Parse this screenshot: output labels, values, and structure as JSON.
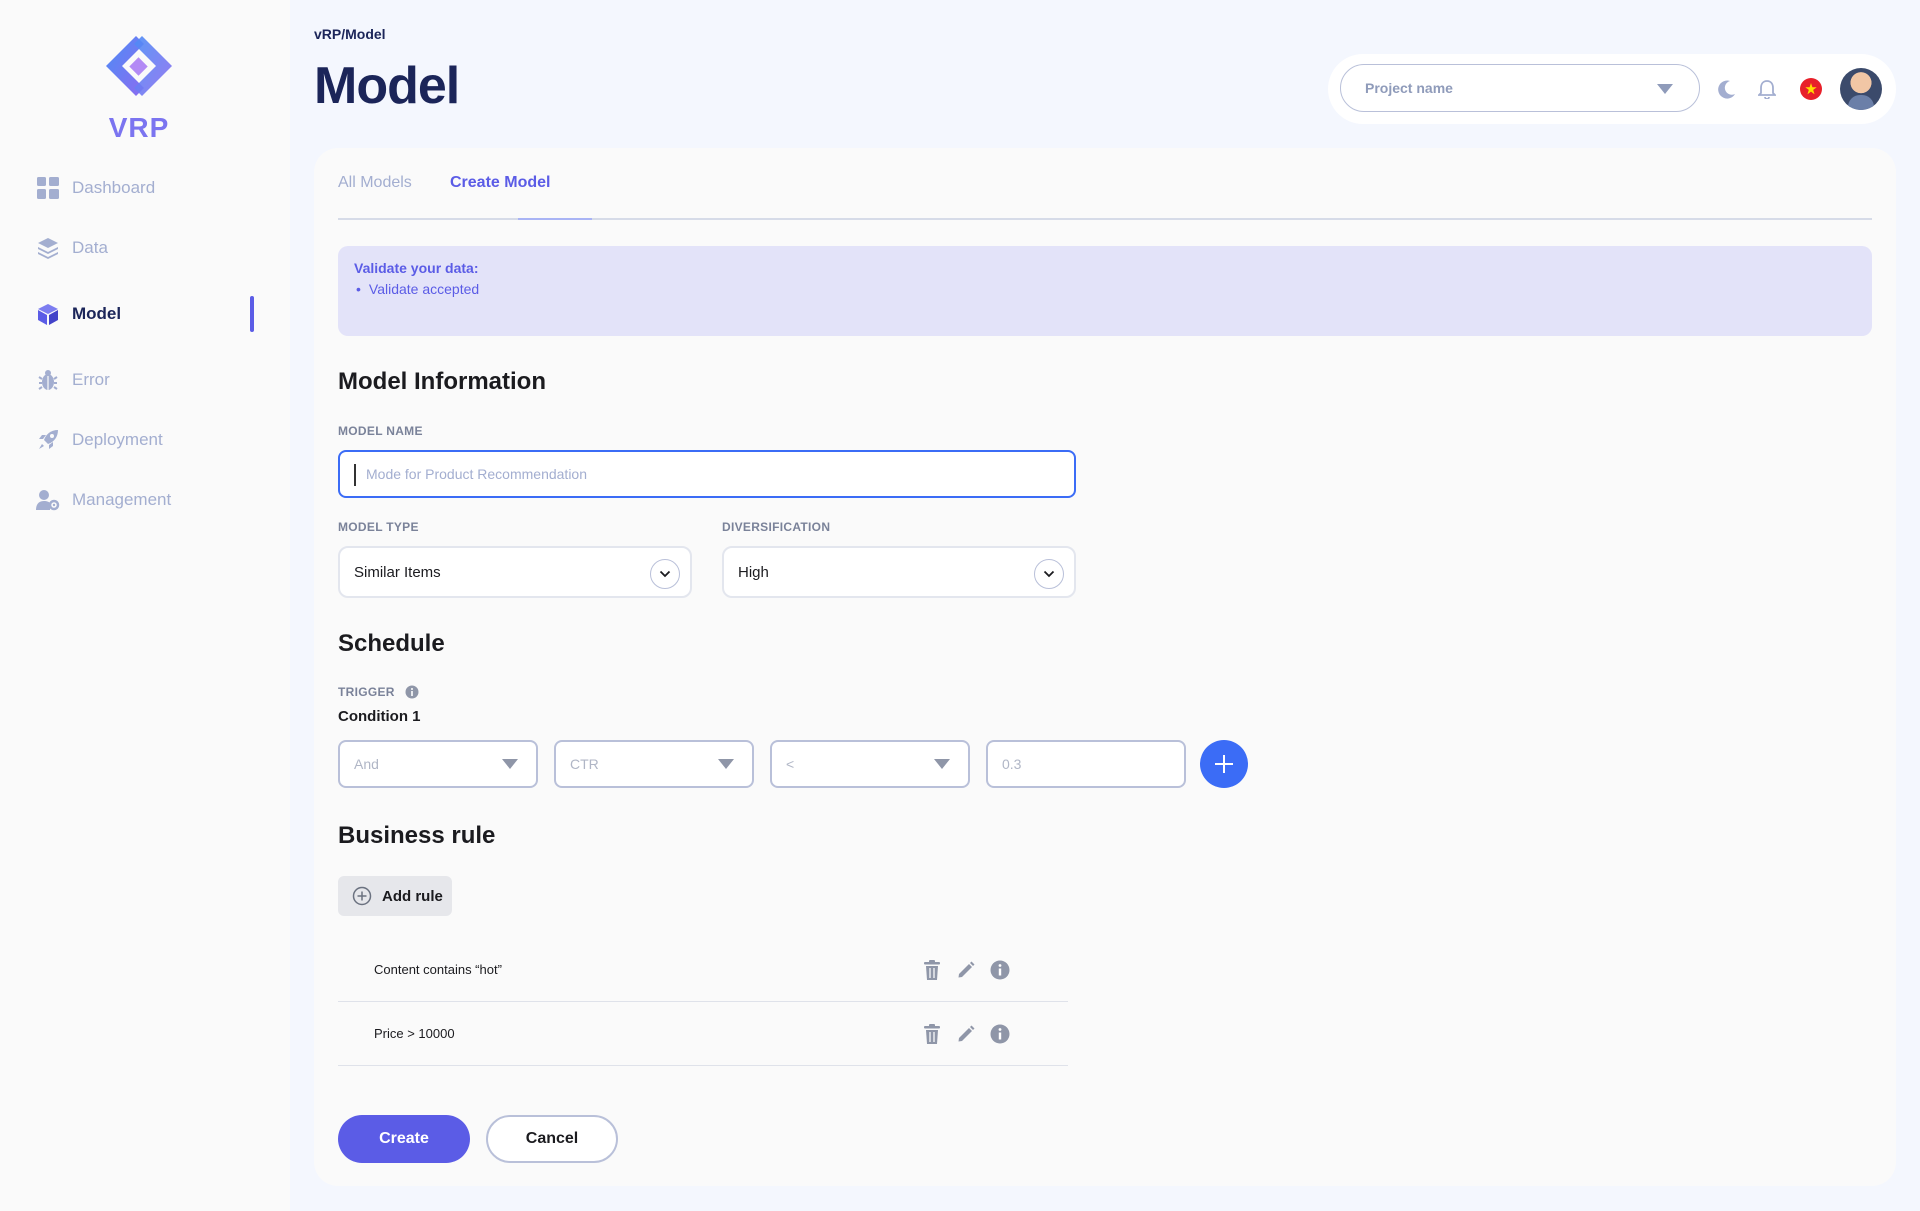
{
  "app": {
    "logo_text": "VRP"
  },
  "sidebar": {
    "items": [
      {
        "label": "Dashboard",
        "icon": "dashboard-icon",
        "active": false
      },
      {
        "label": "Data",
        "icon": "layers-icon",
        "active": false
      },
      {
        "label": "Model",
        "icon": "cube-icon",
        "active": true
      },
      {
        "label": "Error",
        "icon": "bug-icon",
        "active": false
      },
      {
        "label": "Deployment",
        "icon": "rocket-icon",
        "active": false
      },
      {
        "label": "Management",
        "icon": "user-gear-icon",
        "active": false
      }
    ]
  },
  "header": {
    "breadcrumb": "vRP/Model",
    "title": "Model",
    "project_select": {
      "placeholder": "Project name"
    },
    "icons": [
      "moon-icon",
      "bell-icon",
      "vietnam-flag-icon",
      "avatar"
    ]
  },
  "tabs": [
    {
      "label": "All Models",
      "active": false
    },
    {
      "label": "Create Model",
      "active": true
    }
  ],
  "alert": {
    "title": "Validate your data:",
    "items": [
      "Validate accepted"
    ]
  },
  "model_info": {
    "section_title": "Model Information",
    "model_name": {
      "label": "MODEL NAME",
      "placeholder": "Mode for Product Recommendation",
      "value": ""
    },
    "model_type": {
      "label": "MODEL TYPE",
      "value": "Similar Items"
    },
    "diversification": {
      "label": "DIVERSIFICATION",
      "value": "High"
    }
  },
  "schedule": {
    "section_title": "Schedule",
    "trigger_label": "TRIGGER",
    "condition_label": "Condition 1",
    "condition": {
      "logic": "And",
      "metric": "CTR",
      "operator": "<",
      "value_placeholder": "0.3"
    }
  },
  "business_rule": {
    "section_title": "Business rule",
    "add_label": "Add rule",
    "rules": [
      {
        "text": "Content contains “hot”"
      },
      {
        "text": "Price > 10000"
      }
    ]
  },
  "actions": {
    "create_label": "Create",
    "cancel_label": "Cancel"
  },
  "colors": {
    "accent": "#5b5ce6",
    "primary_blue": "#3b6cf6",
    "text_dark": "#1b2559",
    "muted": "#a3aed0"
  }
}
